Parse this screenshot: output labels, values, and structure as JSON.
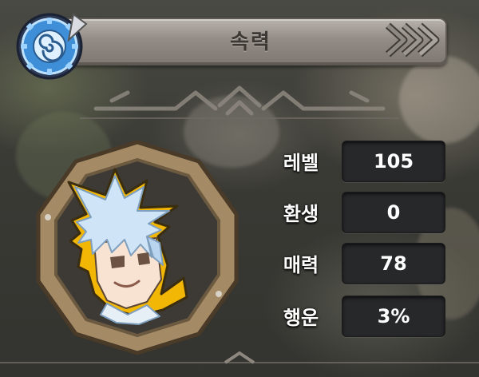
{
  "title": "속력",
  "colors": {
    "title_text": "#3d3833",
    "stat_value_bg": "#27282a",
    "frame_wood": "#a58a66",
    "portrait_outline": "#f2b705",
    "hair": "#cfe4f7"
  },
  "icons": {
    "emblem": "spiral-gear-icon",
    "chevrons": "chevrons-right-icon",
    "divider": "ornament-divider-icon"
  },
  "character": {
    "portrait": "character-portrait"
  },
  "stats": [
    {
      "label": "레벨",
      "value": "105"
    },
    {
      "label": "환생",
      "value": "0"
    },
    {
      "label": "매력",
      "value": "78"
    },
    {
      "label": "행운",
      "value": "3%"
    }
  ]
}
